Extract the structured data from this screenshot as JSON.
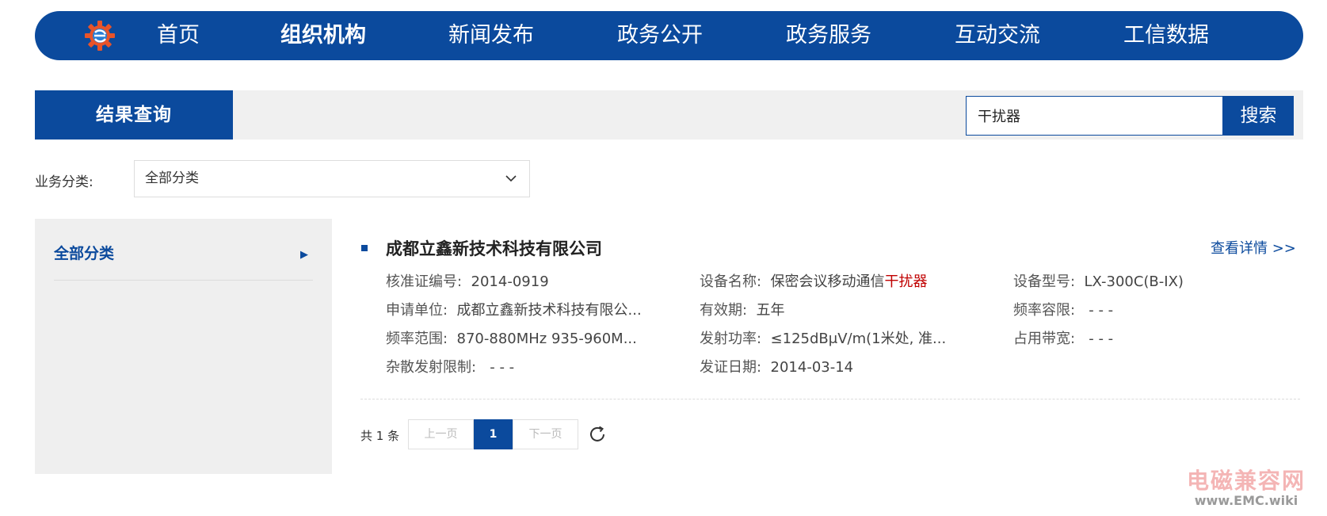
{
  "nav": {
    "items": [
      "首页",
      "组织机构",
      "新闻发布",
      "政务公开",
      "政务服务",
      "互动交流",
      "工信数据"
    ],
    "active_index": 1
  },
  "results": {
    "tab_label": "结果查询",
    "search": {
      "value": "干扰器",
      "button_label": "搜索"
    }
  },
  "filter": {
    "label": "业务分类:",
    "selected": "全部分类"
  },
  "sidebar": {
    "items": [
      {
        "label": "全部分类"
      }
    ]
  },
  "record": {
    "company": "成都立鑫新技术科技有限公司",
    "detail_link": "查看详情 >>",
    "fields": {
      "cert_no": {
        "key": "核准证编号:",
        "value": "2014-0919"
      },
      "device": {
        "key": "设备名称:",
        "value_prefix": "保密会议移动通信",
        "value_highlight": "干扰器"
      },
      "model": {
        "key": "设备型号:",
        "value": "LX-300C(B-IX)"
      },
      "applicant": {
        "key": "申请单位:",
        "value": "成都立鑫新技术科技有限公..."
      },
      "validity": {
        "key": "有效期:",
        "value": "五年"
      },
      "freq_tol": {
        "key": "频率容限:",
        "value": "- - -"
      },
      "freq_range": {
        "key": "频率范围:",
        "value": "870-880MHz 935-960M..."
      },
      "power": {
        "key": "发射功率:",
        "value": "≤125dBμV/m(1米处, 准..."
      },
      "bandwidth": {
        "key": "占用带宽:",
        "value": "- - -"
      },
      "spurious": {
        "key": "杂散发射限制:",
        "value": "- - -"
      },
      "issue_date": {
        "key": "发证日期:",
        "value": "2014-03-14"
      }
    }
  },
  "pagination": {
    "total": "共 1 条",
    "prev": "上一页",
    "current": "1",
    "next": "下一页"
  },
  "watermark": {
    "cn": "电磁兼容网",
    "en": "www.EMC.wiki"
  },
  "colors": {
    "brand": "#0b4a9d",
    "highlight": "#c00000"
  }
}
